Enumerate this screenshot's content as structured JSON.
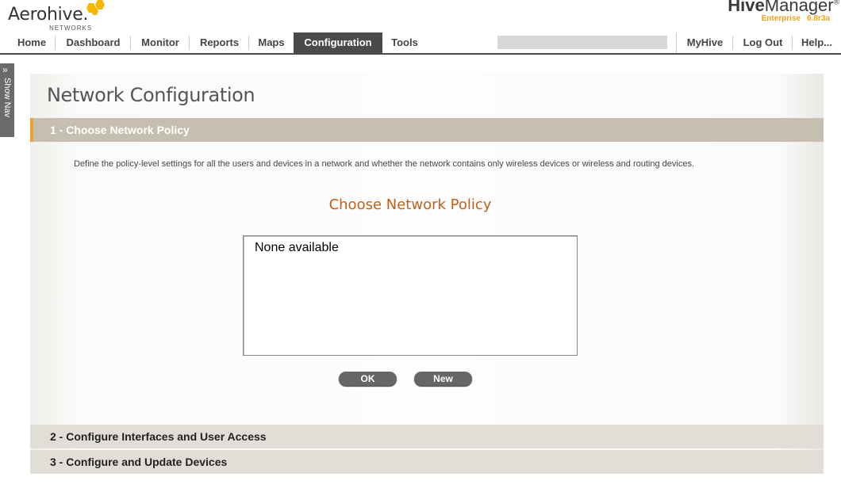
{
  "header": {
    "logo_text": "Aerohive.",
    "logo_sub": "NETWORKS",
    "brand_bold": "Hive",
    "brand_rest": "Manager",
    "brand_reg": "®",
    "edition": "Enterprise",
    "version": "6.8r3a"
  },
  "nav": {
    "items": [
      "Home",
      "Dashboard",
      "Monitor",
      "Reports",
      "Maps",
      "Configuration",
      "Tools"
    ],
    "active": "Configuration",
    "right_items": [
      "MyHive",
      "Log Out",
      "Help..."
    ]
  },
  "sidenav": {
    "label": "Show Nav",
    "icon": "double-chevron-right-icon"
  },
  "page": {
    "title": "Network Configuration",
    "step1": "1 - Choose Network Policy",
    "description": "Define the policy-level settings for all the users and devices in a network and whether the network contains only wireless devices or wireless and routing devices.",
    "choose_title": "Choose Network Policy",
    "list_items": [
      "None available"
    ],
    "ok_label": "OK",
    "new_label": "New",
    "step2": "2 - Configure Interfaces and User Access",
    "step3": "3 - Configure and Update Devices"
  },
  "colors": {
    "accent": "#f0a030",
    "nav_active_bg": "#4a4a4a",
    "step_header_bg": "#c4bfb1",
    "choose_title": "#c0601a"
  }
}
